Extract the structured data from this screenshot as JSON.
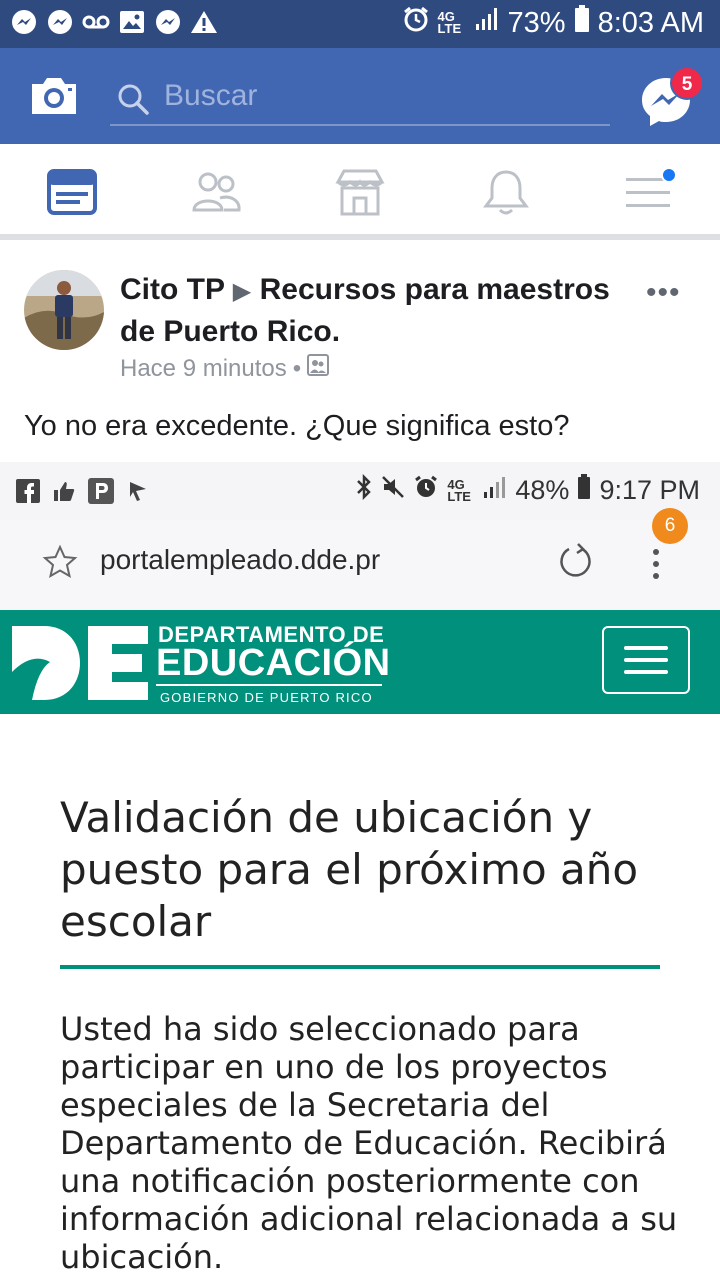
{
  "status_bar": {
    "battery_percent": "73%",
    "time": "8:03 AM",
    "network": "4G LTE",
    "icons": [
      "messenger-icon",
      "messenger-icon",
      "voicemail-icon",
      "image-icon",
      "messenger-icon",
      "warning-icon",
      "alarm-icon",
      "signal-icon",
      "battery-icon"
    ]
  },
  "fb_header": {
    "search_placeholder": "Buscar",
    "messenger_badge": "5",
    "accent_color": "#4267b2"
  },
  "nav_tabs": [
    {
      "name": "news-feed",
      "active": true
    },
    {
      "name": "friends",
      "active": false
    },
    {
      "name": "marketplace",
      "active": false
    },
    {
      "name": "notifications",
      "active": false
    },
    {
      "name": "menu",
      "active": false,
      "has_dot": true
    }
  ],
  "post": {
    "author": "Cito TP",
    "group": "Recursos para maestros de Puerto Rico.",
    "timestamp": "Hace 9 minutos",
    "separator": "•",
    "text": "Yo no era excedente.  ¿Que significa esto?"
  },
  "embedded_screenshot": {
    "status": {
      "battery_percent": "48%",
      "time": "9:17 PM",
      "network": "4G LTE"
    },
    "url": "portalempleado.dde.pr",
    "menu_badge": "6",
    "site_header": {
      "line1": "DEPARTAMENTO DE",
      "line2": "EDUCACIÓN",
      "line3": "GOBIERNO DE PUERTO RICO",
      "brand_color": "#00907c"
    },
    "page_title": "Validación de ubicación y puesto para el próximo año escolar",
    "page_body": "Usted ha sido seleccionado para participar en uno de los proyectos especiales de la Secretaria del Departamento de Educación. Recibirá una notificación posteriormente con información adicional relacionada a su ubicación."
  }
}
